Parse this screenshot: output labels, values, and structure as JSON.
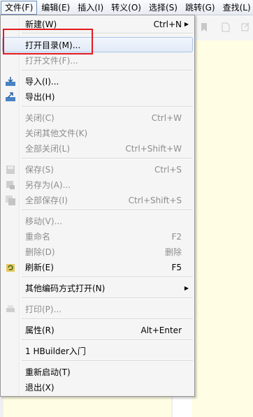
{
  "menubar": {
    "items": [
      {
        "label": "文件(F)"
      },
      {
        "label": "编辑(E)"
      },
      {
        "label": "插入(I)"
      },
      {
        "label": "转义(O)"
      },
      {
        "label": "选择(S)"
      },
      {
        "label": "跳转(G)"
      },
      {
        "label": "查找(L)"
      }
    ]
  },
  "file_menu": {
    "items": [
      {
        "label": "新建(W)",
        "shortcut": "Ctrl+N",
        "submenu": true,
        "enabled": true
      },
      {
        "label": "打开目录(M)...",
        "shortcut": "",
        "enabled": true,
        "highlighted": true
      },
      {
        "label": "打开文件(F)...",
        "shortcut": "",
        "enabled": false
      },
      {
        "label": "导入(I)...",
        "shortcut": "",
        "enabled": true,
        "icon": "import-icon"
      },
      {
        "label": "导出(H)",
        "shortcut": "",
        "enabled": true,
        "icon": "export-icon"
      },
      {
        "label": "关闭(C)",
        "shortcut": "Ctrl+W",
        "enabled": false
      },
      {
        "label": "关闭其他文件(K)",
        "shortcut": "",
        "enabled": false
      },
      {
        "label": "全部关闭(L)",
        "shortcut": "Ctrl+Shift+W",
        "enabled": false
      },
      {
        "label": "保存(S)",
        "shortcut": "Ctrl+S",
        "enabled": false,
        "icon": "save-icon"
      },
      {
        "label": "另存为(A)...",
        "shortcut": "",
        "enabled": false,
        "icon": "save-as-icon"
      },
      {
        "label": "全部保存(I)",
        "shortcut": "Ctrl+Shift+S",
        "enabled": false,
        "icon": "save-all-icon"
      },
      {
        "label": "移动(V)...",
        "shortcut": "",
        "enabled": false
      },
      {
        "label": "重命名",
        "shortcut": "F2",
        "enabled": false
      },
      {
        "label": "删除(D)",
        "shortcut": "删除",
        "enabled": false
      },
      {
        "label": "刷新(E)",
        "shortcut": "F5",
        "enabled": true,
        "icon": "refresh-icon"
      },
      {
        "label": "其他编码方式打开(N)",
        "shortcut": "",
        "submenu": true,
        "enabled": true
      },
      {
        "label": "打印(P)...",
        "shortcut": "",
        "enabled": false,
        "icon": "print-icon"
      },
      {
        "label": "属性(R)",
        "shortcut": "Alt+Enter",
        "enabled": true
      },
      {
        "label": "1 HBuilder入门",
        "shortcut": "",
        "enabled": true
      },
      {
        "label": "重新启动(T)",
        "shortcut": "",
        "enabled": true
      },
      {
        "label": "退出(X)",
        "shortcut": "",
        "enabled": true
      }
    ]
  },
  "icons": {
    "submenu_arrow": "▶",
    "toolbar": [
      "bookmark-icon",
      "page-icon",
      "link-icon"
    ]
  },
  "colors": {
    "highlight_border": "#a9c4ea",
    "annotation_box": "#e3191c",
    "editor_background": "#fffde3"
  }
}
